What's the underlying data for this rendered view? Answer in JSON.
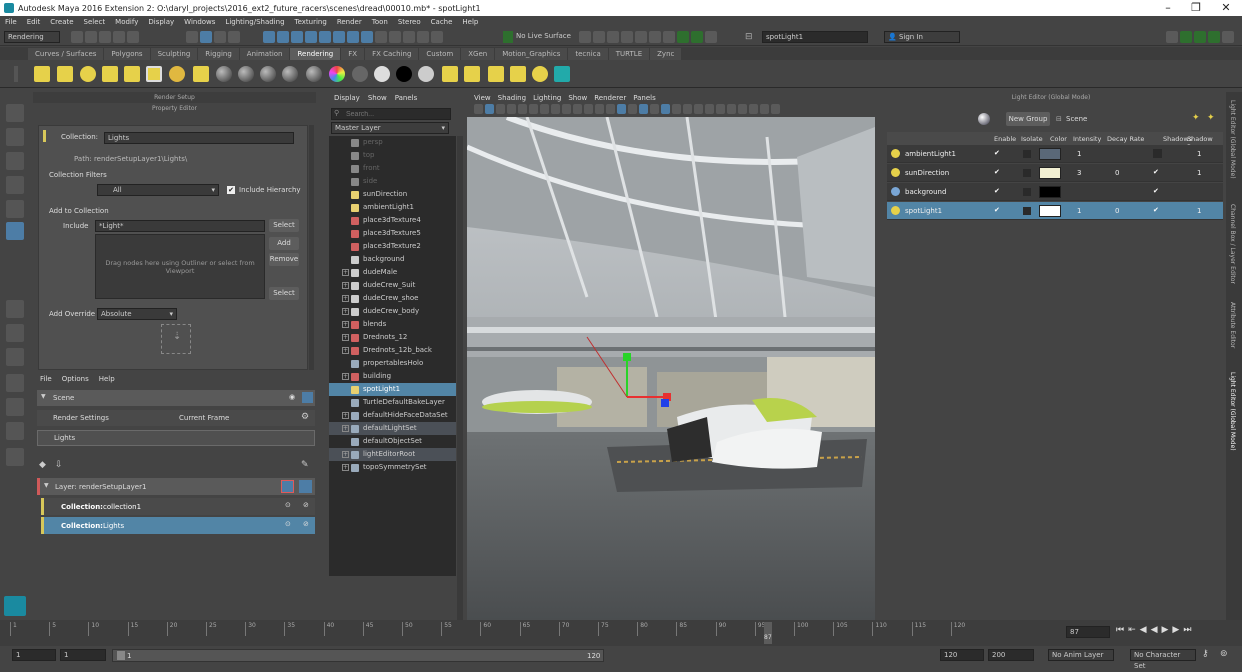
{
  "window": {
    "title": "Autodesk Maya 2016 Extension 2: O:\\daryl_projects\\2016_ext2_future_racers\\scenes\\dread\\00010.mb* - spotLight1"
  },
  "menubar": [
    "File",
    "Edit",
    "Create",
    "Select",
    "Modify",
    "Display",
    "Windows",
    "Lighting/Shading",
    "Texturing",
    "Render",
    "Toon",
    "Stereo",
    "Cache",
    "Help"
  ],
  "statusline": {
    "mode": "Rendering",
    "live_surface": "No Live Surface",
    "search_value": "spotLight1",
    "sign_in": "Sign In"
  },
  "shelf_tabs": [
    "Curves / Surfaces",
    "Polygons",
    "Sculpting",
    "Rigging",
    "Animation",
    "Rendering",
    "FX",
    "FX Caching",
    "Custom",
    "XGen",
    "Motion_Graphics",
    "tecnica",
    "TURTLE",
    "Zync"
  ],
  "shelf_active": "Rendering",
  "render_setup": {
    "title": "Render Setup",
    "property_editor_title": "Property Editor",
    "collection_label": "Collection:",
    "collection_name": "Lights",
    "path": "Path: renderSetupLayer1\\Lights\\",
    "filters_label": "Collection Filters",
    "filter_value": "All",
    "include_hierarchy": "Include Hierarchy",
    "add_to_collection": "Add to Collection",
    "include_label": "Include",
    "include_value": "*Light*",
    "select_btn": "Select",
    "add_btn": "Add",
    "remove_btn": "Remove",
    "select_btn2": "Select",
    "drag_hint": "Drag nodes here using Outliner or select from Viewport",
    "add_override_label": "Add Override",
    "add_override_value": "Absolute",
    "menu": [
      "File",
      "Options",
      "Help"
    ],
    "scene_label": "Scene",
    "render_settings": "Render Settings",
    "current_frame": "Current Frame",
    "lights": "Lights",
    "layer_label": "Layer:",
    "layer_name": "renderSetupLayer1",
    "collections": [
      {
        "label": "Collection:",
        "name": "collection1",
        "selected": false
      },
      {
        "label": "Collection:",
        "name": "Lights",
        "selected": true
      }
    ]
  },
  "outliner": {
    "menu": [
      "Display",
      "Show",
      "Panels"
    ],
    "search_placeholder": "Search...",
    "layer": "Master Layer",
    "items": [
      {
        "name": "persp",
        "state": "dim",
        "exp": false,
        "color": "#888"
      },
      {
        "name": "top",
        "state": "dim",
        "exp": false,
        "color": "#888"
      },
      {
        "name": "front",
        "state": "dim",
        "exp": false,
        "color": "#888"
      },
      {
        "name": "side",
        "state": "dim",
        "exp": false,
        "color": "#888"
      },
      {
        "name": "sunDirection",
        "state": "",
        "exp": false,
        "color": "#e8d070"
      },
      {
        "name": "ambientLight1",
        "state": "",
        "exp": false,
        "color": "#e8d070"
      },
      {
        "name": "place3dTexture4",
        "state": "",
        "exp": false,
        "color": "#d06060"
      },
      {
        "name": "place3dTexture5",
        "state": "",
        "exp": false,
        "color": "#d06060"
      },
      {
        "name": "place3dTexture2",
        "state": "",
        "exp": false,
        "color": "#d06060"
      },
      {
        "name": "background",
        "state": "",
        "exp": false,
        "color": "#ccc"
      },
      {
        "name": "dudeMale",
        "state": "",
        "exp": true,
        "color": "#ccc"
      },
      {
        "name": "dudeCrew_Suit",
        "state": "",
        "exp": true,
        "color": "#ccc"
      },
      {
        "name": "dudeCrew_shoe",
        "state": "",
        "exp": true,
        "color": "#ccc"
      },
      {
        "name": "dudeCrew_body",
        "state": "",
        "exp": true,
        "color": "#ccc"
      },
      {
        "name": "blends",
        "state": "",
        "exp": true,
        "color": "#d06060"
      },
      {
        "name": "Drednots_12",
        "state": "",
        "exp": true,
        "color": "#d06060"
      },
      {
        "name": "Drednots_12b_back",
        "state": "",
        "exp": true,
        "color": "#d06060"
      },
      {
        "name": "propertablesHolo",
        "state": "",
        "exp": false,
        "color": "#9ab"
      },
      {
        "name": "building",
        "state": "",
        "exp": true,
        "color": "#d06060"
      },
      {
        "name": "spotLight1",
        "state": "sel",
        "exp": false,
        "color": "#e8d070"
      },
      {
        "name": "TurtleDefaultBakeLayer",
        "state": "",
        "exp": false,
        "color": "#9ab"
      },
      {
        "name": "defaultHideFaceDataSet",
        "state": "",
        "exp": true,
        "color": "#9ab"
      },
      {
        "name": "defaultLightSet",
        "state": "hl",
        "exp": true,
        "color": "#9ab"
      },
      {
        "name": "defaultObjectSet",
        "state": "",
        "exp": false,
        "color": "#9ab"
      },
      {
        "name": "lightEditorRoot",
        "state": "hl",
        "exp": true,
        "color": "#9ab"
      },
      {
        "name": "topoSymmetrySet",
        "state": "",
        "exp": true,
        "color": "#9ab"
      }
    ]
  },
  "viewport": {
    "menu": [
      "View",
      "Shading",
      "Lighting",
      "Show",
      "Renderer",
      "Panels"
    ]
  },
  "light_editor": {
    "title": "Light Editor (Global Mode)",
    "new_group": "New Group",
    "scene": "Scene",
    "columns": [
      "Enable",
      "Isolate",
      "Color",
      "Intensity",
      "Decay Rate",
      "Shadows",
      "Shadow Rays"
    ],
    "rows": [
      {
        "name": "ambientLight1",
        "enable": "✔",
        "color": "#5a6878",
        "intensity": "1",
        "decay": "",
        "shadows": "",
        "shadow_rays": "1",
        "sel": false
      },
      {
        "name": "sunDirection",
        "enable": "✔",
        "color": "#f2efd2",
        "intensity": "3",
        "decay": "0",
        "shadows": "✔",
        "shadow_rays": "1",
        "sel": false
      },
      {
        "name": "background",
        "enable": "✔",
        "color": "#000000",
        "intensity": "",
        "decay": "",
        "shadows": "✔",
        "shadow_rays": "",
        "sel": false
      },
      {
        "name": "spotLight1",
        "enable": "✔",
        "color": "#ffffff",
        "intensity": "1",
        "decay": "0",
        "shadows": "✔",
        "shadow_rays": "1",
        "sel": true
      }
    ],
    "side_tabs": [
      "Light Editor (Global Mode)",
      "Channel Box / Layer Editor",
      "Attribute Editor",
      "Light Editor (Global Mode)"
    ]
  },
  "timeline": {
    "ticks": [
      "1",
      "5",
      "10",
      "15",
      "20",
      "25",
      "30",
      "35",
      "40",
      "45",
      "50",
      "55",
      "60",
      "65",
      "70",
      "75",
      "80",
      "85",
      "90",
      "95",
      "100",
      "105",
      "110",
      "115",
      "120"
    ],
    "current": "87",
    "current_field": "87"
  },
  "range": {
    "start": "1",
    "start2": "1",
    "slider_start": "1",
    "slider_end": "120",
    "end": "120",
    "end2": "200",
    "anim_layer": "No Anim Layer",
    "char_set": "No Character Set"
  }
}
